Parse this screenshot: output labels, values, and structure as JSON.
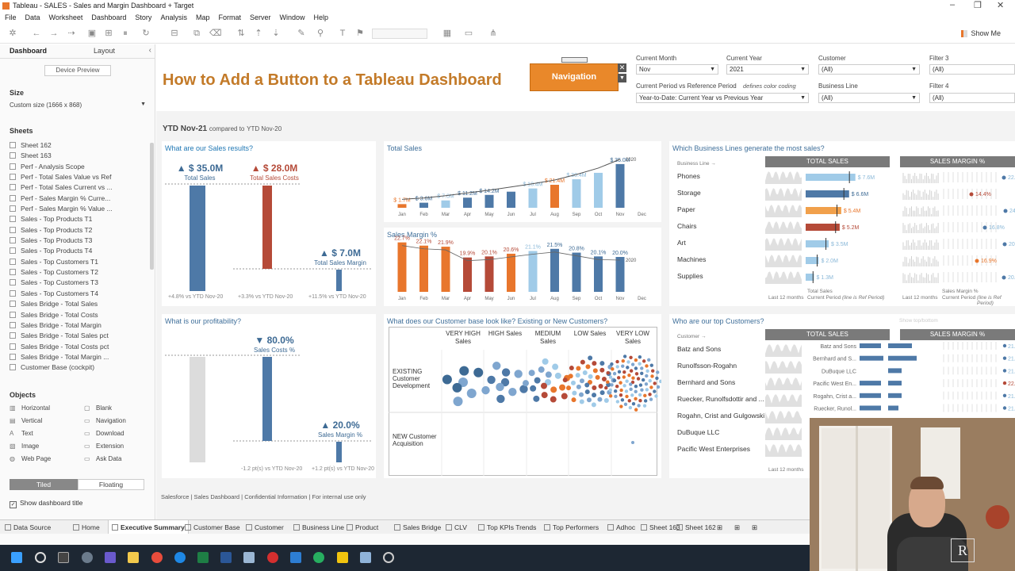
{
  "window": {
    "title": "Tableau - SALES - Sales and Margin Dashboard + Target"
  },
  "menu": [
    "File",
    "Data",
    "Worksheet",
    "Dashboard",
    "Story",
    "Analysis",
    "Map",
    "Format",
    "Server",
    "Window",
    "Help"
  ],
  "toolbar": {
    "show_me": "Show Me"
  },
  "left_pane": {
    "tab_dashboard": "Dashboard",
    "tab_layout": "Layout",
    "device_preview": "Device Preview",
    "size_heading": "Size",
    "size_value": "Custom size (1666 x 868)",
    "sheets_heading": "Sheets",
    "sheets": [
      "Sheet 162",
      "Sheet 163",
      "Perf - Analysis Scope",
      "Perf - Total Sales Value vs Ref",
      "Perf - Total Sales Current vs ...",
      "Perf - Sales Margin % Curre...",
      "Perf - Sales Margin % Value ...",
      "Sales - Top Products T1",
      "Sales - Top Products T2",
      "Sales - Top Products T3",
      "Sales - Top Products T4",
      "Sales - Top Customers T1",
      "Sales - Top Customers T2",
      "Sales - Top Customers T3",
      "Sales - Top Customers T4",
      "Sales Bridge - Total Sales",
      "Sales Bridge - Total Costs",
      "Sales Bridge - Total Margin",
      "Sales Bridge - Total Sales pct",
      "Sales Bridge - Total Costs pct",
      "Sales Bridge - Total Margin ...",
      "Customer Base (cockpit)"
    ],
    "objects_heading": "Objects",
    "objects": [
      {
        "label": "Horizontal",
        "icon": "▥"
      },
      {
        "label": "Blank",
        "icon": "▢"
      },
      {
        "label": "Vertical",
        "icon": "▤"
      },
      {
        "label": "Navigation",
        "icon": "▭"
      },
      {
        "label": "Text",
        "icon": "A"
      },
      {
        "label": "Download",
        "icon": "▭"
      },
      {
        "label": "Image",
        "icon": "▧"
      },
      {
        "label": "Extension",
        "icon": "▭"
      },
      {
        "label": "Web Page",
        "icon": "◍"
      },
      {
        "label": "Ask Data",
        "icon": "▭"
      }
    ],
    "tiled": "Tiled",
    "floating": "Floating",
    "show_title": "Show dashboard title"
  },
  "dashboard": {
    "title": "How to Add a Button to a Tableau Dashboard",
    "nav_button": "Navigation",
    "filters": {
      "current_month": {
        "label": "Current Month",
        "value": "Nov"
      },
      "current_year": {
        "label": "Current Year",
        "value": "2021"
      },
      "customer": {
        "label": "Customer",
        "value": "(All)"
      },
      "filter3": {
        "label": "Filter 3",
        "value": "(All)"
      },
      "period": {
        "label": "Current Period vs Reference Period",
        "value": "Year-to-Date: Current Year vs Previous Year"
      },
      "defines": "defines color coding",
      "business_line": {
        "label": "Business Line",
        "value": "(All)"
      },
      "filter4": {
        "label": "Filter 4",
        "value": "(All)"
      }
    },
    "ytd": {
      "main": "YTD Nov-21",
      "compared": "compared to",
      "ref": "YTD Nov-20"
    },
    "sales_results": {
      "title": "What are our Sales results?",
      "kpis": [
        {
          "value": "▲ $ 35.0M",
          "label": "Total Sales",
          "foot": "+4.8% vs YTD Nov-20"
        },
        {
          "value": "▲ $ 28.0M",
          "label": "Total Sales Costs",
          "foot": "+3.3% vs YTD Nov-20"
        },
        {
          "value": "▲ $ 7.0M",
          "label": "Total Sales Margin",
          "foot": "+11.5% vs YTD Nov-20"
        }
      ],
      "bar_levels": [
        1.0,
        0.8,
        0.2
      ]
    },
    "profitability": {
      "title": "What is our profitability?",
      "kpis": [
        {
          "value": "▼ 80.0%",
          "label": "Sales Costs %",
          "foot": "-1.2 pt(s) vs YTD Nov-20"
        },
        {
          "value": "▲ 20.0%",
          "label": "Sales Margin %",
          "foot": "+1.2 pt(s) vs YTD Nov-20"
        }
      ]
    },
    "total_sales": {
      "title": "Total Sales",
      "months": [
        "Jan",
        "Feb",
        "Mar",
        "Apr",
        "May",
        "Jun",
        "Jul",
        "Aug",
        "Sep",
        "Oct",
        "Nov",
        "Dec"
      ],
      "values": [
        1.7,
        3.6,
        7.0,
        11.2,
        14.2,
        null,
        18.4,
        21.4,
        30.4,
        null,
        35.0,
        null
      ],
      "bar_fraction": [
        0.08,
        0.11,
        0.16,
        0.22,
        0.28,
        0.35,
        0.42,
        0.5,
        0.62,
        0.76,
        0.95,
        0
      ],
      "bar_colors": [
        "#e8762c",
        "#4e79a7",
        "#a0cbe8",
        "#4e79a7",
        "#4e79a7",
        "#4e79a7",
        "#a0cbe8",
        "#e8762c",
        "#a0cbe8",
        "#a0cbe8",
        "#4e79a7",
        "#ffffff"
      ],
      "labels": [
        "$ 1.7M",
        "$ 3.6M",
        "$ 7.0M",
        "$ 11.2M",
        "$ 14.2M",
        "",
        "$ 18.4M",
        "$ 21.4M",
        "$ 30.4M",
        "",
        "$ 35.0M",
        ""
      ],
      "ref": "2020"
    },
    "sales_margin": {
      "title": "Sales Margin %",
      "labels": [
        "22.7%",
        "22.1%",
        "21.9%",
        "19.9%",
        "20.1%",
        "20.6%",
        "21.1%",
        "21.5%",
        "20.8%",
        "20.1%",
        "20.0%",
        ""
      ],
      "values": [
        22.7,
        22.1,
        21.9,
        19.9,
        20.1,
        20.6,
        21.1,
        21.5,
        20.8,
        20.1,
        20.0,
        null
      ],
      "bar_colors": [
        "#e8762c",
        "#e8762c",
        "#e8762c",
        "#b54a38",
        "#b54a38",
        "#e8762c",
        "#a0cbe8",
        "#4e79a7",
        "#4e79a7",
        "#4e79a7",
        "#4e79a7",
        "#ffffff"
      ],
      "ref": "2020"
    },
    "business_lines": {
      "title": "Which Business Lines generate the most sales?",
      "axis_label": "Business Line →",
      "col_sales": "TOTAL SALES",
      "col_margin": "SALES MARGIN %",
      "rows": [
        {
          "name": "Phones",
          "sales": "$ 7.6M",
          "margin": "22.1",
          "fill": 0.95,
          "color": "#a0cbe8"
        },
        {
          "name": "Storage",
          "sales": "$ 6.6M",
          "margin": "14.4%",
          "fill": 0.83,
          "color": "#4e79a7"
        },
        {
          "name": "Paper",
          "sales": "$ 5.4M",
          "margin": "24.",
          "fill": 0.68,
          "color": "#f1a04b"
        },
        {
          "name": "Chairs",
          "sales": "$ 5.2M",
          "margin": "16.8%",
          "fill": 0.65,
          "color": "#b54a38"
        },
        {
          "name": "Art",
          "sales": "$ 3.5M",
          "margin": "20.5%",
          "fill": 0.44,
          "color": "#a0cbe8"
        },
        {
          "name": "Machines",
          "sales": "$ 2.0M",
          "margin": "16.9%",
          "fill": 0.25,
          "color": "#a0cbe8"
        },
        {
          "name": "Supplies",
          "sales": "$ 1.3M",
          "margin": "20.1%",
          "fill": 0.16,
          "color": "#a0cbe8"
        }
      ],
      "last12": "Last 12 months",
      "total_sales_note": "Total Sales",
      "current_period": "Current Period",
      "line_is_ref": "(line is Ref Period)",
      "margin_note": "Sales Margin %"
    },
    "customer_base": {
      "title": "What does our Customer base look like? Existing or New Customers?",
      "columns": [
        "VERY HIGH Sales",
        "HIGH Sales",
        "MEDIUM Sales",
        "LOW Sales",
        "VERY LOW Sales"
      ],
      "rows": [
        "EXISTING Customer Development",
        "NEW Customer Acquisition"
      ]
    },
    "top_customers": {
      "title": "Who are our top Customers?",
      "show_top": "Show top/bottom",
      "axis_label": "Customer →",
      "col_sales": "TOTAL SALES",
      "col_margin": "SALES MARGIN %",
      "names": [
        "Batz and Sons",
        "Runolfsson-Rogahn",
        "Bernhard and Sons",
        "Ruecker, Runolfsdottir and ...",
        "Rogahn, Crist and Gulgowski",
        "DuBuque LLC",
        "Pacific West Enterprises"
      ],
      "bar_names": [
        "Batz and Sons",
        "Bernhard and S...",
        "DuBuque LLC",
        "Pacific West En...",
        "Rogahn, Crist a...",
        "Ruecker, Runol..."
      ],
      "margins": [
        "21.",
        "21.",
        "21.",
        "22.",
        "21.",
        "21."
      ],
      "last12": "Last 12 months"
    },
    "footer": "Salesforce | Sales Dashboard | Confidential Information | For internal use only"
  },
  "bottom_tabs": [
    "Data Source",
    "Home",
    "Executive Summary",
    "Customer Base",
    "Customer",
    "Business Line",
    "Product",
    "Sales Bridge",
    "CLV",
    "Top KPIs Trends",
    "Top Performers",
    "Adhoc",
    "Sheet 163",
    "Sheet 162"
  ],
  "colors": {
    "accent_orange": "#e9882a",
    "title_brown": "#c37a28",
    "blue": "#4e79a7",
    "light_blue": "#a0cbe8",
    "red": "#b54a38"
  }
}
